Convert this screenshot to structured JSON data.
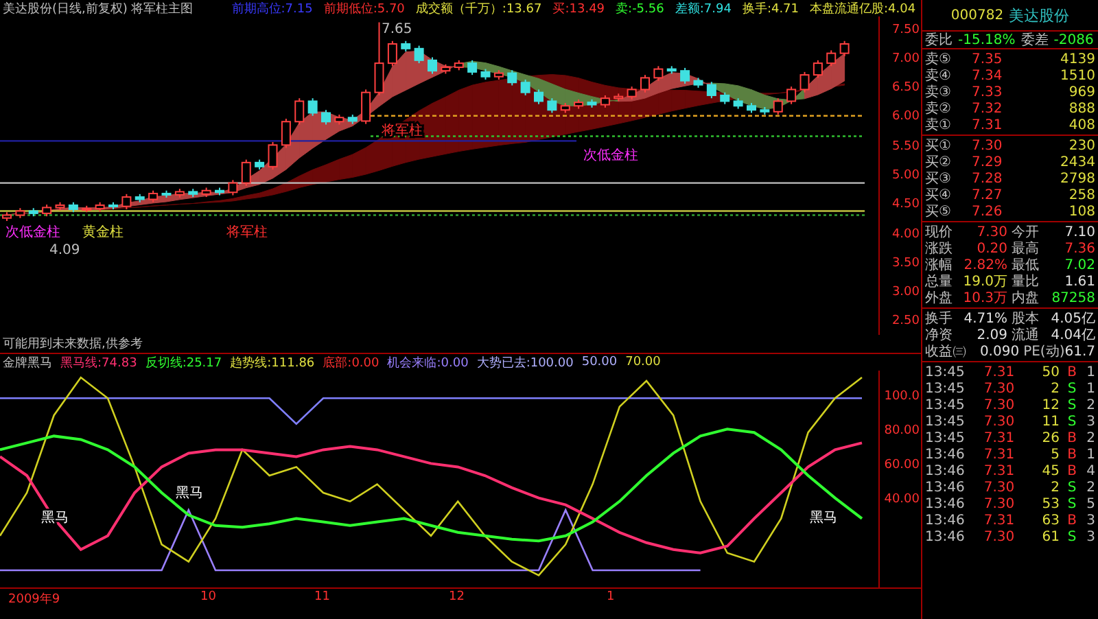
{
  "title_bar": {
    "title": "美达股份(日线,前复权) 将军柱主图",
    "items": [
      {
        "text": "前期高位:7.15",
        "color": "#3a3aff"
      },
      {
        "text": "前期低位:5.70",
        "color": "#ff3030"
      },
      {
        "text": "成交额（千万）:13.67",
        "color": "#e0e040"
      },
      {
        "text": "买:13.49",
        "color": "#ff3030"
      },
      {
        "text": "卖:-5.56",
        "color": "#30ff30"
      },
      {
        "text": "差额:7.94",
        "color": "#30e0e0"
      },
      {
        "text": "换手:4.71",
        "color": "#e0e040"
      },
      {
        "text": "本盘流通亿股:4.04",
        "color": "#e0e040"
      }
    ]
  },
  "main_chart": {
    "labels": [
      {
        "text": "7.65",
        "color": "#c0c0c0"
      },
      {
        "text": "将军柱",
        "color": "#ff3030"
      },
      {
        "text": "次低金柱",
        "color": "#ff30ff"
      },
      {
        "text": "次低金柱",
        "color": "#ff30ff"
      },
      {
        "text": "黄金柱",
        "color": "#e0e040"
      },
      {
        "text": "将军柱",
        "color": "#ff3030"
      },
      {
        "text": "4.09",
        "color": "#c0c0c0"
      }
    ],
    "chart_data": {
      "type": "candlestick",
      "ylim": [
        2.3,
        7.75
      ],
      "yticks": [
        {
          "value": 7.5,
          "label": "7.50"
        },
        {
          "value": 7,
          "label": "7.00"
        },
        {
          "value": 6.5,
          "label": "6.50"
        },
        {
          "value": 6,
          "label": "6.00"
        },
        {
          "value": 5.5,
          "label": "5.50"
        },
        {
          "value": 5,
          "label": "5.00"
        },
        {
          "value": 4.5,
          "label": "4.50"
        },
        {
          "value": 4,
          "label": "4.00"
        },
        {
          "value": 3.5,
          "label": "3.50"
        },
        {
          "value": 3,
          "label": "3.00"
        },
        {
          "value": 2.5,
          "label": "2.50"
        }
      ],
      "ohlc": [
        [
          4.3,
          4.4,
          4.25,
          4.35
        ],
        [
          4.35,
          4.47,
          4.3,
          4.42
        ],
        [
          4.42,
          4.47,
          4.33,
          4.38
        ],
        [
          4.38,
          4.53,
          4.33,
          4.48
        ],
        [
          4.48,
          4.57,
          4.43,
          4.52
        ],
        [
          4.52,
          4.57,
          4.4,
          4.45
        ],
        [
          4.45,
          4.51,
          4.4,
          4.46
        ],
        [
          4.46,
          4.57,
          4.41,
          4.52
        ],
        [
          4.52,
          4.57,
          4.45,
          4.5
        ],
        [
          4.5,
          4.71,
          4.45,
          4.66
        ],
        [
          4.66,
          4.71,
          4.57,
          4.62
        ],
        [
          4.62,
          4.77,
          4.57,
          4.72
        ],
        [
          4.72,
          4.77,
          4.65,
          4.7
        ],
        [
          4.7,
          4.8,
          4.65,
          4.75
        ],
        [
          4.75,
          4.8,
          4.66,
          4.71
        ],
        [
          4.71,
          4.82,
          4.66,
          4.77
        ],
        [
          4.77,
          4.82,
          4.69,
          4.74
        ],
        [
          4.74,
          4.95,
          4.69,
          4.9
        ],
        [
          4.9,
          5.3,
          4.85,
          5.25
        ],
        [
          5.25,
          5.3,
          5.13,
          5.18
        ],
        [
          5.18,
          5.6,
          5.13,
          5.55
        ],
        [
          5.55,
          6.0,
          5.5,
          5.95
        ],
        [
          5.95,
          6.35,
          5.9,
          6.3
        ],
        [
          6.3,
          6.35,
          6.05,
          6.1
        ],
        [
          6.1,
          6.15,
          5.9,
          5.95
        ],
        [
          5.95,
          6.07,
          5.9,
          6.02
        ],
        [
          6.02,
          6.07,
          5.91,
          5.96
        ],
        [
          5.96,
          6.5,
          5.91,
          6.45
        ],
        [
          6.45,
          7.65,
          6.4,
          6.95
        ],
        [
          6.95,
          7.33,
          6.9,
          7.28
        ],
        [
          7.28,
          7.33,
          7.15,
          7.2
        ],
        [
          7.2,
          7.25,
          6.95,
          7.0
        ],
        [
          7.0,
          7.05,
          6.77,
          6.82
        ],
        [
          6.82,
          6.93,
          6.77,
          6.88
        ],
        [
          6.88,
          7.0,
          6.83,
          6.95
        ],
        [
          6.95,
          7.0,
          6.75,
          6.8
        ],
        [
          6.8,
          6.85,
          6.67,
          6.72
        ],
        [
          6.72,
          6.83,
          6.67,
          6.78
        ],
        [
          6.78,
          6.83,
          6.57,
          6.62
        ],
        [
          6.62,
          6.67,
          6.4,
          6.45
        ],
        [
          6.45,
          6.5,
          6.25,
          6.3
        ],
        [
          6.3,
          6.35,
          6.1,
          6.15
        ],
        [
          6.15,
          6.27,
          6.1,
          6.22
        ],
        [
          6.22,
          6.33,
          6.17,
          6.28
        ],
        [
          6.28,
          6.33,
          6.19,
          6.24
        ],
        [
          6.24,
          6.4,
          6.19,
          6.35
        ],
        [
          6.35,
          6.43,
          6.3,
          6.38
        ],
        [
          6.38,
          6.55,
          6.33,
          6.5
        ],
        [
          6.5,
          6.75,
          6.45,
          6.7
        ],
        [
          6.7,
          6.9,
          6.65,
          6.85
        ],
        [
          6.85,
          6.9,
          6.77,
          6.82
        ],
        [
          6.82,
          6.87,
          6.6,
          6.65
        ],
        [
          6.65,
          6.7,
          6.53,
          6.58
        ],
        [
          6.58,
          6.63,
          6.35,
          6.4
        ],
        [
          6.4,
          6.45,
          6.25,
          6.3
        ],
        [
          6.3,
          6.35,
          6.17,
          6.22
        ],
        [
          6.22,
          6.27,
          6.1,
          6.15
        ],
        [
          6.15,
          6.2,
          6.07,
          6.12
        ],
        [
          6.12,
          6.35,
          6.07,
          6.3
        ],
        [
          6.3,
          6.55,
          6.25,
          6.5
        ],
        [
          6.5,
          6.8,
          6.45,
          6.75
        ],
        [
          6.75,
          7.0,
          6.7,
          6.95
        ],
        [
          6.95,
          7.17,
          6.9,
          7.12
        ],
        [
          7.12,
          7.33,
          7.07,
          7.28
        ]
      ]
    }
  },
  "note": "可能用到未来数据,供参考",
  "indicator": {
    "name": "金牌黑马",
    "items": [
      {
        "text": "黑马线:74.83",
        "color": "#ff3070"
      },
      {
        "text": "反切线:25.17",
        "color": "#30ff30"
      },
      {
        "text": "趋势线:111.86",
        "color": "#e0e040"
      },
      {
        "text": "底部:0.00",
        "color": "#ff3030"
      },
      {
        "text": "机会来临:0.00",
        "color": "#9a80ff"
      },
      {
        "text": "大势已去:100.00",
        "color": "#b0b0ff"
      },
      {
        "text": "50.00",
        "color": "#b0b0ff"
      },
      {
        "text": "70.00",
        "color": "#e0e040"
      }
    ],
    "labels": [
      "黑马",
      "黑马",
      "黑马"
    ],
    "chart_data": {
      "type": "line",
      "ylim": [
        -10,
        116
      ],
      "yticks": [
        {
          "value": 100,
          "label": "100.0"
        },
        {
          "value": 80,
          "label": "80.00"
        },
        {
          "value": 60,
          "label": "60.00"
        },
        {
          "value": 40,
          "label": "40.00"
        }
      ],
      "series": [
        {
          "color": "#8080ff",
          "values": [
            100,
            100,
            100,
            100,
            100,
            100,
            100,
            100,
            100,
            100,
            100,
            85,
            100,
            100,
            100,
            100,
            100,
            100,
            100,
            100,
            100,
            100,
            100,
            100,
            100,
            100,
            100,
            100,
            100,
            100,
            100,
            100,
            100
          ]
        },
        {
          "color": "#9a80ff",
          "values": [
            0,
            0,
            0,
            0,
            0,
            0,
            0,
            35,
            0,
            0,
            0,
            0,
            0,
            0,
            0,
            0,
            0,
            0,
            0,
            0,
            0,
            35,
            0,
            0,
            0,
            0,
            0,
            null,
            null,
            null,
            null,
            null,
            null
          ]
        },
        {
          "color": "#d0d020",
          "values": [
            20,
            45,
            90,
            112,
            100,
            60,
            15,
            5,
            30,
            70,
            55,
            60,
            45,
            40,
            50,
            35,
            20,
            40,
            20,
            5,
            -3,
            15,
            50,
            95,
            110,
            90,
            40,
            10,
            5,
            30,
            80,
            100,
            112
          ]
        },
        {
          "color": "#ff3070",
          "values": [
            66,
            55,
            30,
            12,
            20,
            45,
            60,
            68,
            70,
            70,
            68,
            66,
            70,
            72,
            70,
            66,
            62,
            60,
            55,
            48,
            42,
            38,
            30,
            22,
            16,
            12,
            10,
            14,
            30,
            45,
            60,
            70,
            74
          ]
        },
        {
          "color": "#30ff30",
          "values": [
            70,
            74,
            78,
            76,
            70,
            60,
            45,
            32,
            26,
            25,
            27,
            30,
            28,
            26,
            28,
            30,
            26,
            22,
            20,
            18,
            17,
            20,
            28,
            40,
            55,
            68,
            78,
            82,
            80,
            70,
            55,
            42,
            30
          ]
        }
      ]
    }
  },
  "date_axis": [
    "2009年9",
    "10",
    "11",
    "12",
    "1"
  ],
  "quote": {
    "code": "000782",
    "name": "美达股份",
    "ratio": {
      "label": "委比",
      "value": "-15.18%",
      "diff_label": "委差",
      "diff": "-2086"
    },
    "asks": [
      {
        "label": "卖⑤",
        "price": "7.35",
        "volume": "4139"
      },
      {
        "label": "卖④",
        "price": "7.34",
        "volume": "1510"
      },
      {
        "label": "卖③",
        "price": "7.33",
        "volume": "969"
      },
      {
        "label": "卖②",
        "price": "7.32",
        "volume": "888"
      },
      {
        "label": "卖①",
        "price": "7.31",
        "volume": "408"
      }
    ],
    "bids": [
      {
        "label": "买①",
        "price": "7.30",
        "volume": "230"
      },
      {
        "label": "买②",
        "price": "7.29",
        "volume": "2434"
      },
      {
        "label": "买③",
        "price": "7.28",
        "volume": "2798"
      },
      {
        "label": "买④",
        "price": "7.27",
        "volume": "258"
      },
      {
        "label": "买⑤",
        "price": "7.26",
        "volume": "108"
      }
    ],
    "stats": [
      {
        "cells": [
          {
            "label": "现价",
            "value": "7.30",
            "color": "#ff3030"
          },
          {
            "label": "今开",
            "value": "7.10",
            "color": "#e0e0e0"
          }
        ]
      },
      {
        "cells": [
          {
            "label": "涨跌",
            "value": "0.20",
            "color": "#ff3030"
          },
          {
            "label": "最高",
            "value": "7.36",
            "color": "#ff3030"
          }
        ]
      },
      {
        "cells": [
          {
            "label": "涨幅",
            "value": "2.82%",
            "color": "#ff3030"
          },
          {
            "label": "最低",
            "value": "7.02",
            "color": "#30ff30"
          }
        ]
      },
      {
        "cells": [
          {
            "label": "总量",
            "value": "19.0万",
            "color": "#e0e040"
          },
          {
            "label": "量比",
            "value": "1.61",
            "color": "#e0e0e0"
          }
        ]
      },
      {
        "cells": [
          {
            "label": "外盘",
            "value": "10.3万",
            "color": "#ff3030"
          },
          {
            "label": "内盘",
            "value": "87258",
            "color": "#30ff30"
          }
        ]
      }
    ],
    "stats2": [
      {
        "label": "换手",
        "value": "4.71%",
        "label2": "股本",
        "value2": "4.05亿"
      },
      {
        "label": "净资",
        "value": "2.09",
        "label2": "流通",
        "value2": "4.04亿"
      },
      {
        "label": "收益㈢",
        "value": "0.090",
        "label2": "PE(动)",
        "value2": "61.7"
      }
    ],
    "trades": [
      {
        "time": "13:45",
        "price": "7.31",
        "volume": "50",
        "side": "B",
        "color": "#ff3030",
        "column_5": "1"
      },
      {
        "time": "13:45",
        "price": "7.30",
        "volume": "2",
        "side": "S",
        "color": "#30ff30",
        "column_5": "1"
      },
      {
        "time": "13:45",
        "price": "7.30",
        "volume": "12",
        "side": "S",
        "color": "#30ff30",
        "column_5": "2"
      },
      {
        "time": "13:45",
        "price": "7.30",
        "volume": "11",
        "side": "S",
        "color": "#30ff30",
        "column_5": "3"
      },
      {
        "time": "13:45",
        "price": "7.31",
        "volume": "26",
        "side": "B",
        "color": "#ff3030",
        "column_5": "2"
      },
      {
        "time": "13:46",
        "price": "7.31",
        "volume": "5",
        "side": "B",
        "color": "#ff3030",
        "column_5": "1"
      },
      {
        "time": "13:46",
        "price": "7.31",
        "volume": "45",
        "side": "B",
        "color": "#ff3030",
        "column_5": "4"
      },
      {
        "time": "13:46",
        "price": "7.30",
        "volume": "2",
        "side": "S",
        "color": "#30ff30",
        "column_5": "2"
      },
      {
        "time": "13:46",
        "price": "7.30",
        "volume": "53",
        "side": "S",
        "color": "#30ff30",
        "column_5": "5"
      },
      {
        "time": "13:46",
        "price": "7.31",
        "volume": "63",
        "side": "B",
        "color": "#ff3030",
        "column_5": "3"
      },
      {
        "time": "13:46",
        "price": "7.30",
        "volume": "61",
        "side": "S",
        "color": "#30ff30",
        "column_5": "3"
      }
    ]
  }
}
